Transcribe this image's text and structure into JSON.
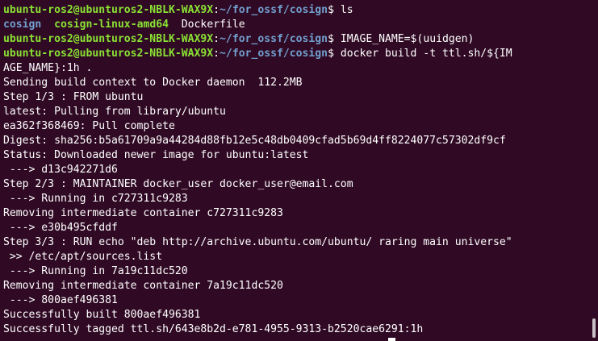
{
  "prompt": {
    "user_host": "ubuntu-ros2@ubunturos2-NBLK-WAX9X",
    "colon": ":",
    "path": "~/for_ossf/cosign",
    "dollar": "$"
  },
  "lines": [
    {
      "type": "prompt",
      "command": " ls"
    },
    {
      "type": "ls",
      "items": [
        "cosign",
        "  ",
        "cosign-linux-amd64",
        "  ",
        "Dockerfile"
      ]
    },
    {
      "type": "prompt",
      "command": " IMAGE_NAME=$(uuidgen)"
    },
    {
      "type": "prompt",
      "command": " docker build -t ttl.sh/${IM"
    },
    {
      "type": "text",
      "text": "AGE_NAME}:1h ."
    },
    {
      "type": "text",
      "text": "Sending build context to Docker daemon  112.2MB"
    },
    {
      "type": "text",
      "text": "Step 1/3 : FROM ubuntu"
    },
    {
      "type": "text",
      "text": "latest: Pulling from library/ubuntu"
    },
    {
      "type": "text",
      "text": "ea362f368469: Pull complete"
    },
    {
      "type": "text",
      "text": "Digest: sha256:b5a61709a9a44284d88fb12e5c48db0409cfad5b69d4ff8224077c57302df9cf"
    },
    {
      "type": "text",
      "text": "Status: Downloaded newer image for ubuntu:latest"
    },
    {
      "type": "text",
      "text": " ---> d13c942271d6"
    },
    {
      "type": "text",
      "text": "Step 2/3 : MAINTAINER docker_user docker_user@email.com"
    },
    {
      "type": "text",
      "text": " ---> Running in c727311c9283"
    },
    {
      "type": "text",
      "text": "Removing intermediate container c727311c9283"
    },
    {
      "type": "text",
      "text": " ---> e30b495cfddf"
    },
    {
      "type": "text",
      "text": "Step 3/3 : RUN echo \"deb http://archive.ubuntu.com/ubuntu/ raring main universe\""
    },
    {
      "type": "text",
      "text": " >> /etc/apt/sources.list"
    },
    {
      "type": "text",
      "text": " ---> Running in 7a19c11dc520"
    },
    {
      "type": "text",
      "text": "Removing intermediate container 7a19c11dc520"
    },
    {
      "type": "text",
      "text": " ---> 800aef496381"
    },
    {
      "type": "text",
      "text": "Successfully built 800aef496381"
    },
    {
      "type": "text",
      "text": "Successfully tagged ttl.sh/643e8b2d-e781-4955-9313-b2520cae6291:1h"
    }
  ],
  "colors": {
    "background": "#300a24",
    "user_host": "#8ae234",
    "path": "#729fcf",
    "text": "#ffffff"
  }
}
